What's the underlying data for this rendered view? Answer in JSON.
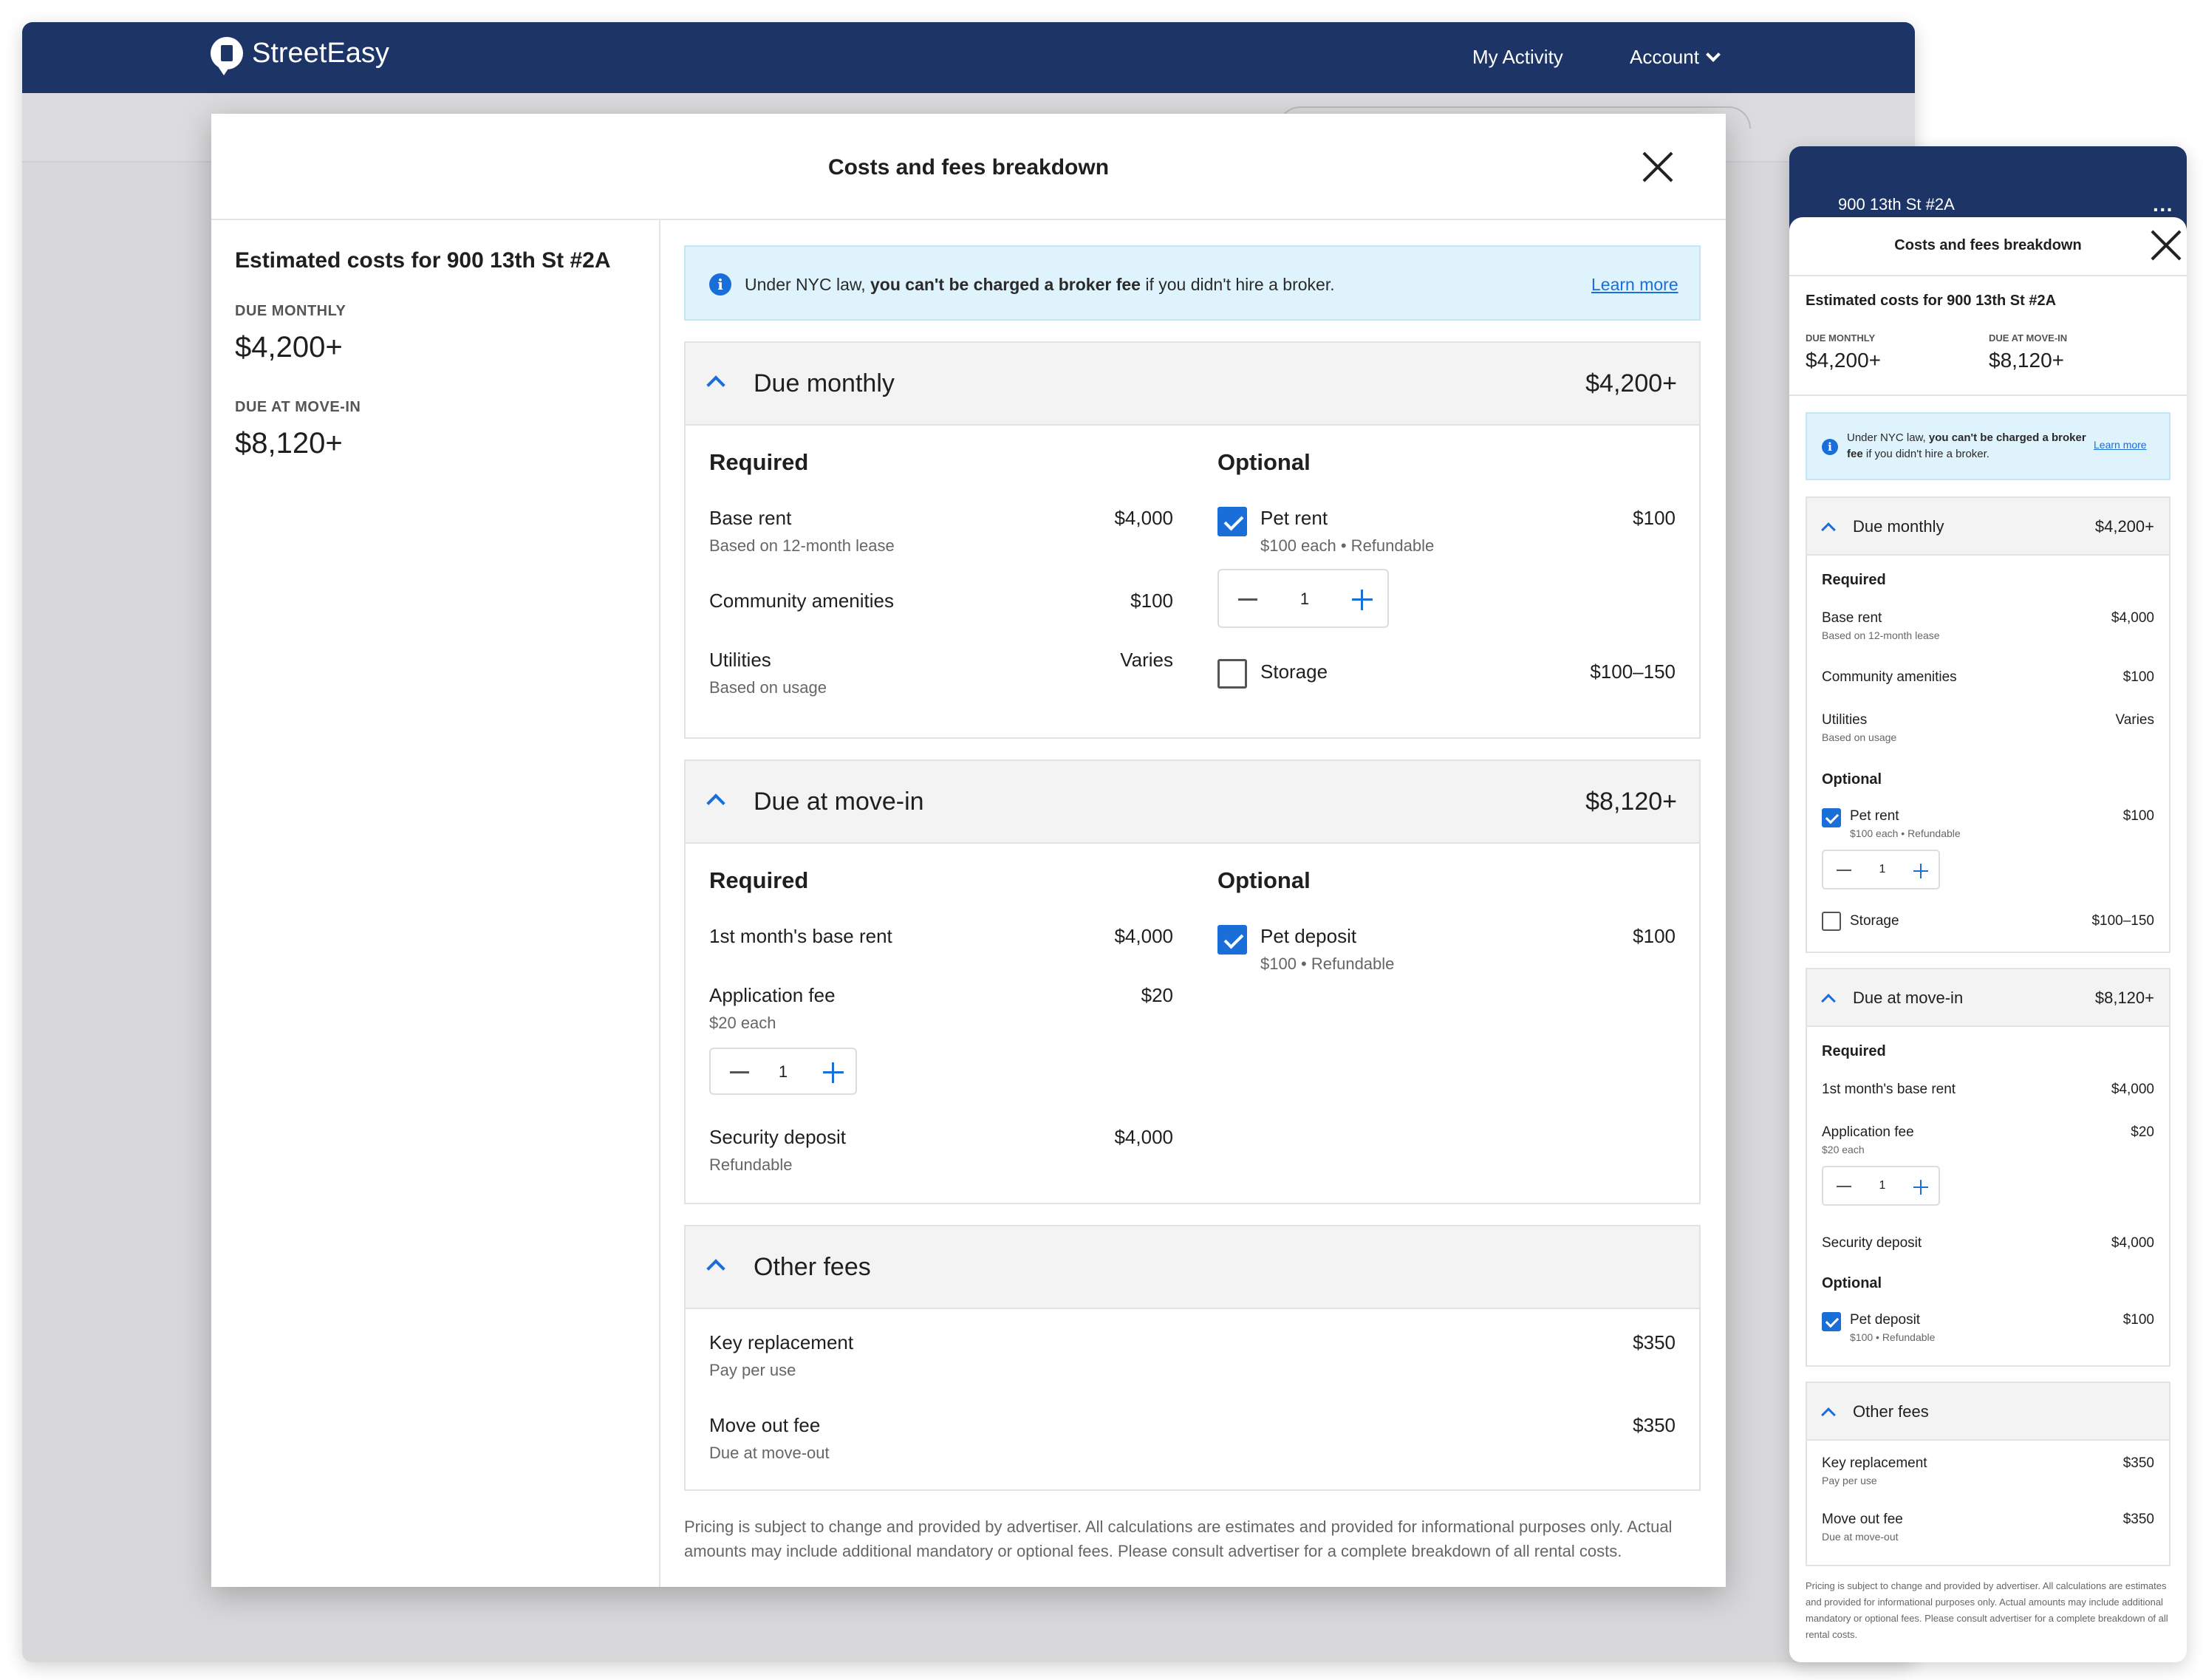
{
  "app": {
    "brand": "StreetEasy",
    "nav_activity": "My Activity",
    "nav_account": "Account"
  },
  "modal": {
    "title": "Costs and fees breakdown",
    "estimate_title": "Estimated costs for 900 13th St #2A",
    "due_monthly_label": "DUE MONTHLY",
    "due_monthly_amount": "$4,200+",
    "due_movein_label": "DUE AT MOVE-IN",
    "due_movein_amount": "$8,120+",
    "banner": {
      "prefix": "Under NYC law, ",
      "bold": "you can't be charged a broker fee",
      "suffix": " if you didn't hire a broker.",
      "link": "Learn more"
    },
    "required_label": "Required",
    "optional_label": "Optional",
    "monthly": {
      "title": "Due monthly",
      "amount": "$4,200+",
      "required": [
        {
          "name": "Base rent",
          "note": "Based on 12-month lease",
          "amount": "$4,000"
        },
        {
          "name": "Community amenities",
          "note": "",
          "amount": "$100"
        },
        {
          "name": "Utilities",
          "note": "Based on usage",
          "amount": "Varies"
        }
      ],
      "optional": [
        {
          "name": "Pet rent",
          "note": "$100 each • Refundable",
          "amount": "$100",
          "checked": true,
          "qty": "1"
        },
        {
          "name": "Storage",
          "note": "",
          "amount": "$100–150",
          "checked": false
        }
      ]
    },
    "movein": {
      "title": "Due at move-in",
      "amount": "$8,120+",
      "required": [
        {
          "name": "1st month's base rent",
          "note": "",
          "amount": "$4,000"
        },
        {
          "name": "Application fee",
          "note": "$20 each",
          "amount": "$20",
          "qty": "1"
        },
        {
          "name": "Security deposit",
          "note": "Refundable",
          "amount": "$4,000"
        }
      ],
      "optional": [
        {
          "name": "Pet deposit",
          "note": "$100 • Refundable",
          "amount": "$100",
          "checked": true
        }
      ]
    },
    "other": {
      "title": "Other fees",
      "items": [
        {
          "name": "Key replacement",
          "note": "Pay per use",
          "amount": "$350"
        },
        {
          "name": "Move out fee",
          "note": "Due at move-out",
          "amount": "$350"
        }
      ]
    },
    "footer": "Pricing is subject to change and provided by advertiser. All calculations are estimates and provided for informational purposes only. Actual amounts may include additional mandatory or optional fees. Please consult advertiser for a complete breakdown of all rental costs."
  },
  "mobile": {
    "address": "900 13th St #2A",
    "footer": "Pricing is subject to change and provided by advertiser. All calculations are estimates and provided for informational purposes only. Actual amounts may include additional mandatory or optional fees. Please consult advertiser for a complete breakdown of all rental costs.",
    "pet_rent_note": "$100 each • Refundable",
    "pet_deposit_note": "$100 • Refundable"
  },
  "icons": {
    "info": "info-icon",
    "close": "close-icon",
    "chevron_up": "chevron-up-icon",
    "check": "check-icon"
  },
  "colors": {
    "header": "#1d3467",
    "accent": "#1a6ed8",
    "banner_bg": "#dff3fc"
  }
}
